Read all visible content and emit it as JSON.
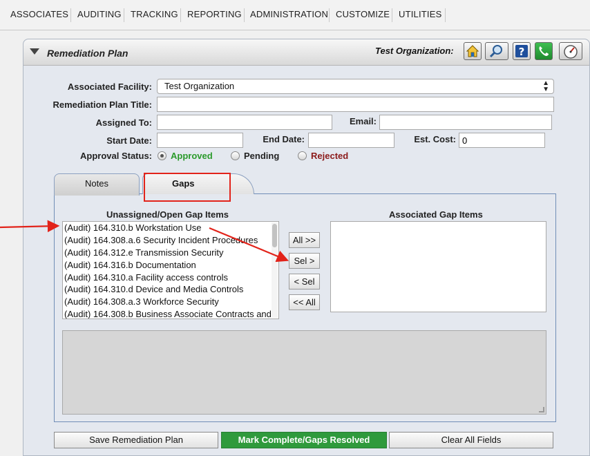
{
  "nav": [
    "ASSOCIATES",
    "AUDITING",
    "TRACKING",
    "REPORTING",
    "ADMINISTRATION",
    "CUSTOMIZE",
    "UTILITIES"
  ],
  "panel": {
    "title": "Remediation Plan",
    "org_label": "Test Organization:",
    "icons": [
      "home-icon",
      "search-icon",
      "help-icon",
      "phone-icon",
      "gauge-icon"
    ]
  },
  "form": {
    "facility_label": "Associated Facility:",
    "facility_value": "Test Organization",
    "plan_title_label": "Remediation Plan Title:",
    "plan_title_value": "",
    "assigned_label": "Assigned To:",
    "assigned_value": "",
    "email_label": "Email:",
    "email_value": "",
    "start_label": "Start Date:",
    "start_value": "",
    "end_label": "End Date:",
    "end_value": "",
    "cost_label": "Est. Cost:",
    "cost_value": "0",
    "approval_label": "Approval Status:",
    "approval_options": [
      {
        "label": "Approved",
        "color": "#2a9a2a",
        "selected": true
      },
      {
        "label": "Pending",
        "color": "#222222",
        "selected": false
      },
      {
        "label": "Rejected",
        "color": "#8b1a1a",
        "selected": false
      }
    ]
  },
  "tabs": [
    {
      "label": "Notes",
      "active": false
    },
    {
      "label": "Gaps",
      "active": true
    }
  ],
  "gaps": {
    "unassigned_title": "Unassigned/Open Gap Items",
    "associated_title": "Associated Gap Items",
    "unassigned_items": [
      "(Audit) 164.310.b Workstation Use",
      "(Audit) 164.308.a.6 Security Incident Procedures",
      "(Audit) 164.312.e Transmission Security",
      "(Audit) 164.316.b Documentation",
      "(Audit) 164.310.a Facility access controls",
      "(Audit) 164.310.d Device and Media Controls",
      "(Audit) 164.308.a.3 Workforce Security",
      "(Audit) 164.308.b Business Associate Contracts and"
    ],
    "associated_items": [],
    "move_buttons": [
      "All >>",
      "Sel >",
      "< Sel",
      "<< All"
    ]
  },
  "footer": {
    "save_label": "Save Remediation Plan",
    "complete_label": "Mark Complete/Gaps Resolved",
    "clear_label": "Clear All Fields"
  },
  "colors": {
    "annotation": "#e2231a",
    "complete_button": "#2f9a3c"
  }
}
